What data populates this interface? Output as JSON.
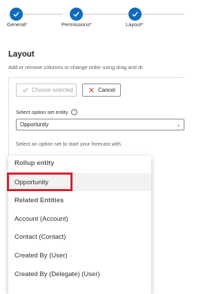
{
  "stepper": {
    "steps": [
      {
        "label": "General*"
      },
      {
        "label": "Permissions*"
      },
      {
        "label": "Layout*"
      }
    ]
  },
  "layout": {
    "title": "Layout",
    "description": "Add or remove columns or change order using drag and dr"
  },
  "toolbar": {
    "choose_selected_label": "Choose selected",
    "cancel_label": "Cancel"
  },
  "option_set": {
    "label": "Select option set entity",
    "value": "Opportunity",
    "hint": "Select an option set to start your forecast with."
  },
  "dropdown": {
    "rollup_header": "Rollup entity",
    "rollup_items": [
      "Opportunity"
    ],
    "related_header": "Related Entities",
    "related_items": [
      "Account (Account)",
      "Contact (Contact)",
      "Created By (User)",
      "Created By (Delegate) (User)"
    ]
  },
  "colors": {
    "accent": "#0f6cbd",
    "highlight_border": "#d81e2c",
    "selected_row": "#f3f2f1"
  }
}
